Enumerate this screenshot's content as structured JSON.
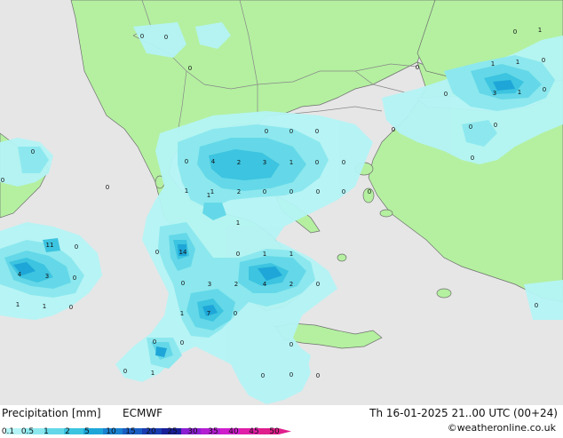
{
  "title": {
    "left": "Precipitation [mm]",
    "model": "ECMWF",
    "valid": "Th 16-01-2025 21..00 UTC (00+24)",
    "credit": "©weatheronline.co.uk"
  },
  "legend": {
    "ticks": [
      "0.1",
      "0.5",
      "1",
      "2",
      "5",
      "10",
      "15",
      "20",
      "25",
      "30",
      "35",
      "40",
      "45",
      "50"
    ],
    "colors": [
      "#b4f4f6",
      "#8ce8ee",
      "#64d8e8",
      "#3cc4e0",
      "#1ea6d8",
      "#1a82d0",
      "#1a5ec4",
      "#1a3cb0",
      "#1a1e98",
      "#8c1ed2",
      "#b41ed2",
      "#d01ecc",
      "#e01ea8",
      "#e01e8c"
    ]
  },
  "precip_values": [
    {
      "v": "0"
    },
    {
      "v": "0"
    },
    {
      "v": "0"
    },
    {
      "v": "0"
    },
    {
      "v": "1"
    },
    {
      "v": "0"
    },
    {
      "v": "1"
    },
    {
      "v": "1"
    },
    {
      "v": "0"
    },
    {
      "v": "0"
    },
    {
      "v": "3"
    },
    {
      "v": "1"
    },
    {
      "v": "0"
    },
    {
      "v": "0"
    },
    {
      "v": "0"
    },
    {
      "v": "0"
    },
    {
      "v": "0"
    },
    {
      "v": "0"
    },
    {
      "v": "0"
    },
    {
      "v": "0"
    },
    {
      "v": "0"
    },
    {
      "v": "4"
    },
    {
      "v": "2"
    },
    {
      "v": "3"
    },
    {
      "v": "1"
    },
    {
      "v": "0"
    },
    {
      "v": "0"
    },
    {
      "v": "0"
    },
    {
      "v": "0"
    },
    {
      "v": "1"
    },
    {
      "v": "1"
    },
    {
      "v": "2"
    },
    {
      "v": "0"
    },
    {
      "v": "0"
    },
    {
      "v": "0"
    },
    {
      "v": "0"
    },
    {
      "v": "0"
    },
    {
      "v": "0"
    },
    {
      "v": "1"
    },
    {
      "v": "11"
    },
    {
      "v": "0"
    },
    {
      "v": "0"
    },
    {
      "v": "14"
    },
    {
      "v": "0"
    },
    {
      "v": "1"
    },
    {
      "v": "1"
    },
    {
      "v": "4"
    },
    {
      "v": "3"
    },
    {
      "v": "0"
    },
    {
      "v": "0"
    },
    {
      "v": "3"
    },
    {
      "v": "2"
    },
    {
      "v": "4"
    },
    {
      "v": "2"
    },
    {
      "v": "0"
    },
    {
      "v": "1"
    },
    {
      "v": "1"
    },
    {
      "v": "0"
    },
    {
      "v": "1"
    },
    {
      "v": "7"
    },
    {
      "v": "0"
    },
    {
      "v": "0"
    },
    {
      "v": "0"
    },
    {
      "v": "0"
    },
    {
      "v": "0"
    },
    {
      "v": "0"
    },
    {
      "v": "1"
    },
    {
      "v": "0"
    },
    {
      "v": "0"
    },
    {
      "v": "0"
    },
    {
      "v": "1"
    }
  ],
  "colors": {
    "sea": "#e6e6e6",
    "land": "#b4f0a0",
    "border": "#888888",
    "coast": "#6e6e6e"
  }
}
